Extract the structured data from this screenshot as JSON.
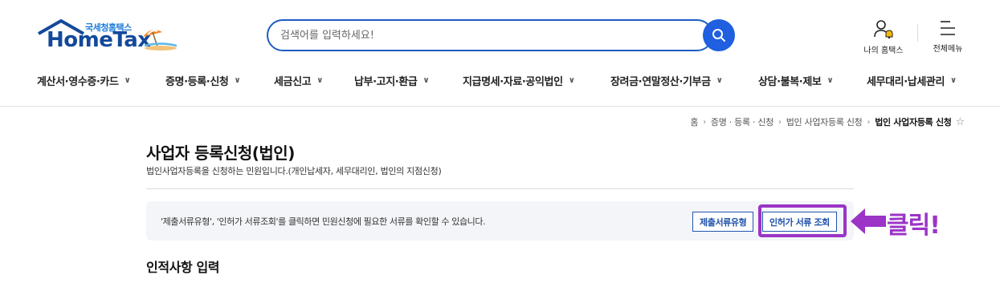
{
  "header": {
    "logo_sub": "국세청홈택스",
    "logo_main": "HomeTax",
    "search": {
      "placeholder": "검색어를 입력하세요!"
    },
    "util": {
      "myhome_label": "나의 홈택스",
      "menu_label": "전체메뉴"
    },
    "gnb": [
      {
        "label": "계산서·영수증·카드"
      },
      {
        "label": "증명·등록·신청"
      },
      {
        "label": "세금신고"
      },
      {
        "label": "납부·고지·환급"
      },
      {
        "label": "지급명세·자료·공익법인"
      },
      {
        "label": "장려금·연말정산·기부금"
      },
      {
        "label": "상담·불복·제보"
      },
      {
        "label": "세무대리·납세관리"
      }
    ]
  },
  "breadcrumb": {
    "items": [
      "홈",
      "증명 · 등록 · 신청",
      "법인 사업자등록 신청"
    ],
    "current": "법인 사업자등록 신청"
  },
  "page": {
    "title": "사업자 등록신청(법인)",
    "description": "법인사업자등록을 신청하는 민원입니다.(개인납세자, 세무대리인, 법인의 지점신청)"
  },
  "info_box": {
    "text": "'제출서류유형', '인허가 서류조회'를 클릭하면 민원신청에 필요한 서류를 확인할 수 있습니다.",
    "btn_doc_type": "제출서류유형",
    "btn_permit_lookup": "인허가 서류 조회"
  },
  "annotation": {
    "text": "클릭!",
    "color": "#9b34c7"
  },
  "section": {
    "title": "인적사항 입력"
  },
  "colors": {
    "brand": "#13499a",
    "search_border": "#1d5cc4",
    "search_button": "#1f5fe0",
    "highlight": "#9b34c7"
  }
}
